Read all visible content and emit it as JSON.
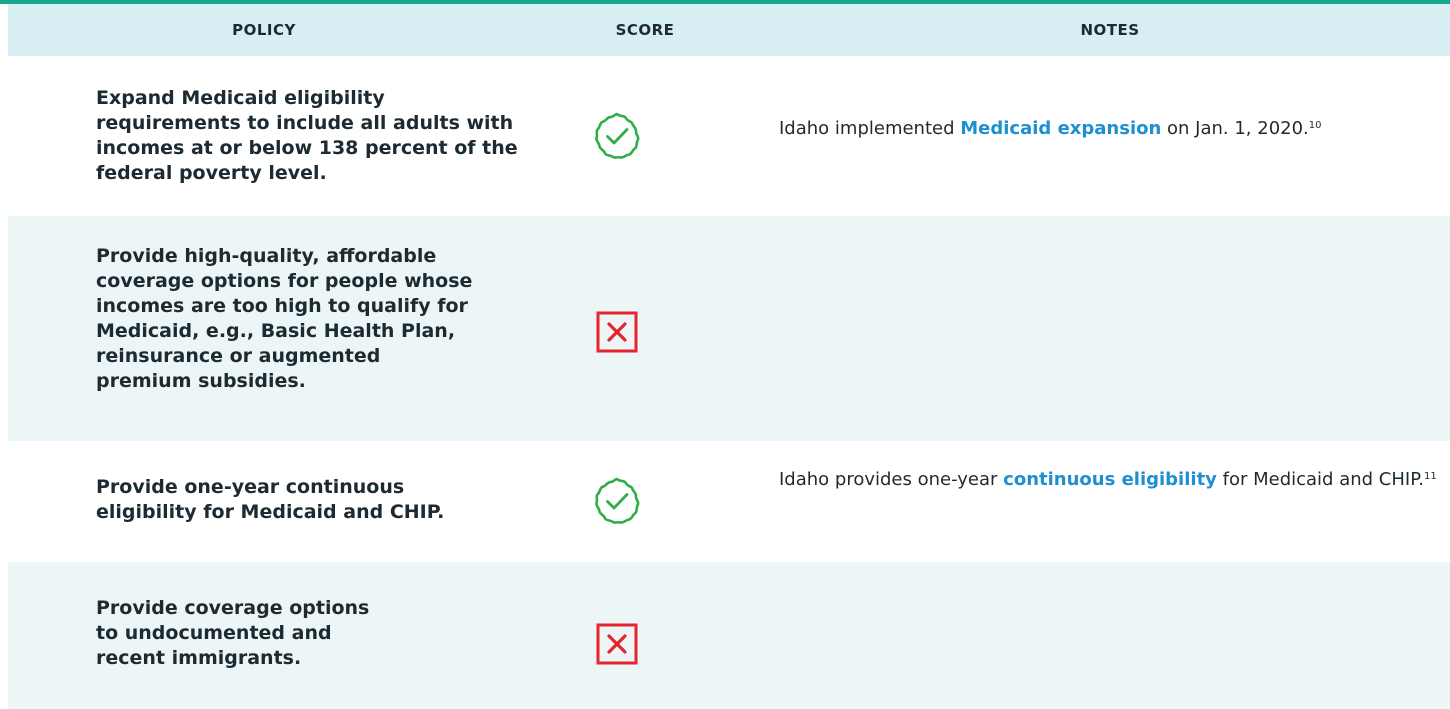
{
  "header": {
    "policy_label": "POLICY",
    "score_label": "SCORE",
    "notes_label": "NOTES"
  },
  "colors": {
    "accent": "#1aa58e",
    "header_bg": "#d7eef2",
    "alt_row_bg": "#ecf6f7",
    "check": "#2fae48",
    "cross": "#e8232e",
    "link": "#1f8fd0"
  },
  "rows": [
    {
      "policy": "Expand Medicaid eligibility requirements to include all adults with incomes at or below 138 percent of the federal poverty level.",
      "score": "check-badge-icon",
      "notes": {
        "before": "Idaho implemented ",
        "link": "Medicaid expansion",
        "after": " on Jan. 1, 2020.",
        "footnote": "10"
      }
    },
    {
      "policy": "Provide high-quality, affordable coverage options for people whose incomes are too high to qualify for Medicaid, e.g., Basic Health Plan, reinsurance or augmented premium subsidies.",
      "score": "cross-box-icon",
      "notes": null
    },
    {
      "policy": "Provide one-year continuous eligibility for Medicaid and CHIP.",
      "score": "check-badge-icon",
      "notes": {
        "before": "Idaho provides one-year ",
        "link": "continuous eligibility",
        "after": " for Medicaid and CHIP.",
        "footnote": "11"
      }
    },
    {
      "policy": "Provide coverage options to undocumented and recent immigrants.",
      "score": "cross-box-icon",
      "notes": null
    }
  ]
}
